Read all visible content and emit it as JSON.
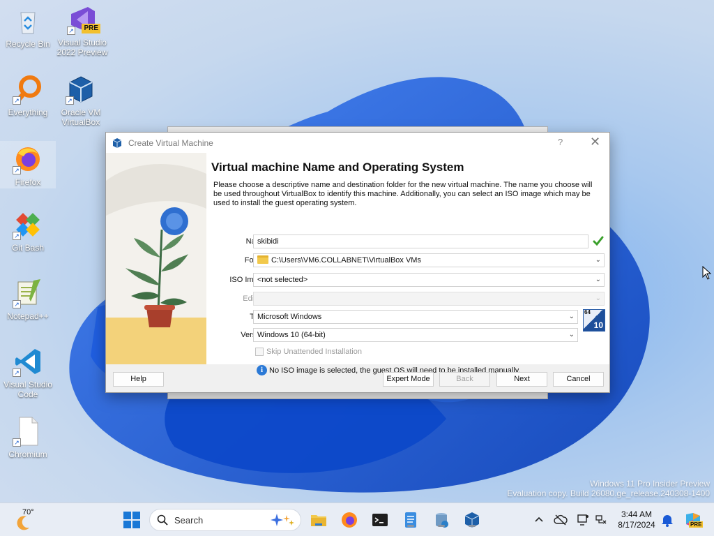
{
  "desktop": {
    "icons": [
      {
        "label": "Recycle Bin",
        "icon": "recycle-bin-icon"
      },
      {
        "label": "Visual Studio 2022 Preview",
        "icon": "visual-studio-icon",
        "badge": "PRE"
      },
      {
        "label": "Everything",
        "icon": "everything-icon"
      },
      {
        "label": "Oracle VM VirtualBox",
        "icon": "virtualbox-icon"
      },
      {
        "label": "Firefox",
        "icon": "firefox-icon"
      },
      {
        "label": "Git Bash",
        "icon": "git-bash-icon"
      },
      {
        "label": "Notepad++",
        "icon": "notepadpp-icon"
      },
      {
        "label": "Visual Studio Code",
        "icon": "vscode-icon"
      },
      {
        "label": "Chromium",
        "icon": "file-icon"
      }
    ]
  },
  "dialog": {
    "title": "Create Virtual Machine",
    "help_glyph": "?",
    "close_glyph": "✕",
    "heading": "Virtual machine Name and Operating System",
    "description": "Please choose a descriptive name and destination folder for the new virtual machine. The name you choose will be used throughout VirtualBox to identify this machine. Additionally, you can select an ISO image which may be used to install the guest operating system.",
    "fields": {
      "name": {
        "label": "Name:",
        "value": "skibidi"
      },
      "folder": {
        "label": "Folder:",
        "value": "C:\\Users\\VM6.COLLABNET\\VirtualBox VMs"
      },
      "iso": {
        "label": "ISO Image:",
        "value": "<not selected>"
      },
      "edition": {
        "label": "Edition:",
        "value": ""
      },
      "type": {
        "label": "Type:",
        "value": "Microsoft Windows"
      },
      "version": {
        "label": "Version:",
        "value": "Windows 10 (64-bit)"
      }
    },
    "os_badge": {
      "top": "64",
      "bottom": "10"
    },
    "skip_unattended": {
      "label": "Skip Unattended Installation",
      "checked": false
    },
    "info_text": "No ISO image is selected, the guest OS will need to be installed manually.",
    "buttons": {
      "help": "Help",
      "expert": "Expert Mode",
      "back": "Back",
      "next": "Next",
      "cancel": "Cancel"
    }
  },
  "watermark": {
    "line1": "Windows 11 Pro Insider Preview",
    "line2": "Evaluation copy. Build 26080.ge_release.240308-1400"
  },
  "taskbar": {
    "weather_temp": "70°",
    "search_placeholder": "Search",
    "time": "3:44 AM",
    "date": "8/17/2024",
    "copilot_badge": "PRE",
    "colors": {
      "accent": "#0067c0",
      "bar": "#e8edf5"
    }
  }
}
